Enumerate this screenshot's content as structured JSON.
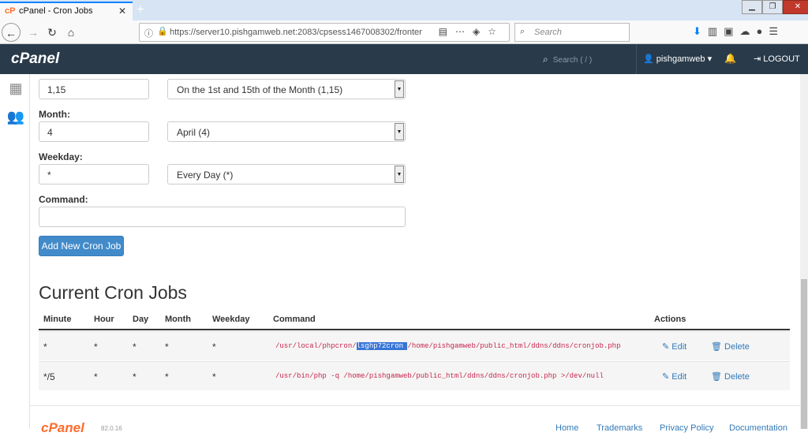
{
  "browser": {
    "tab_title": "cPanel - Cron Jobs",
    "tab_icon": "cP",
    "url": "https://server10.pishgamweb.net:2083/cpsess1467008302/fronten",
    "search_placeholder": "Search"
  },
  "cpanel_header": {
    "logo": "cPanel",
    "search_placeholder": "Search ( / )",
    "username": "pishgamweb",
    "logout_label": "LOGOUT"
  },
  "form": {
    "day_value": "1,15",
    "day_select": "On the 1st and 15th of the Month (1,15)",
    "month_label": "Month:",
    "month_value": "4",
    "month_select": "April (4)",
    "weekday_label": "Weekday:",
    "weekday_value": "*",
    "weekday_select": "Every Day (*)",
    "command_label": "Command:",
    "command_value": "",
    "add_button": "Add New Cron Job"
  },
  "current": {
    "heading": "Current Cron Jobs",
    "columns": [
      "Minute",
      "Hour",
      "Day",
      "Month",
      "Weekday",
      "Command",
      "Actions"
    ],
    "rows": [
      {
        "minute": "*",
        "hour": "*",
        "day": "*",
        "month": "*",
        "weekday": "*",
        "cmd_pre": "/usr/local/phpcron/",
        "cmd_sel": "lsghp72cron ",
        "cmd_post": "/home/pishgamweb/public_html/ddns/ddns/cronjob.php"
      },
      {
        "minute": "*/5",
        "hour": "*",
        "day": "*",
        "month": "*",
        "weekday": "*",
        "cmd_pre": "/usr/bin/php -q /home/pishgamweb/public_html/ddns/ddns/cronjob.php >/dev/null",
        "cmd_sel": "",
        "cmd_post": ""
      }
    ],
    "edit_label": "Edit",
    "delete_label": "Delete"
  },
  "footer": {
    "logo": "cPanel",
    "version": "82.0.16",
    "links": [
      "Home",
      "Trademarks",
      "Privacy Policy",
      "Documentation"
    ]
  },
  "colors": {
    "header_bg": "#293a4a",
    "primary_button": "#428bca",
    "link": "#337ab7",
    "code": "#c7254e",
    "selection": "#3875d7"
  }
}
